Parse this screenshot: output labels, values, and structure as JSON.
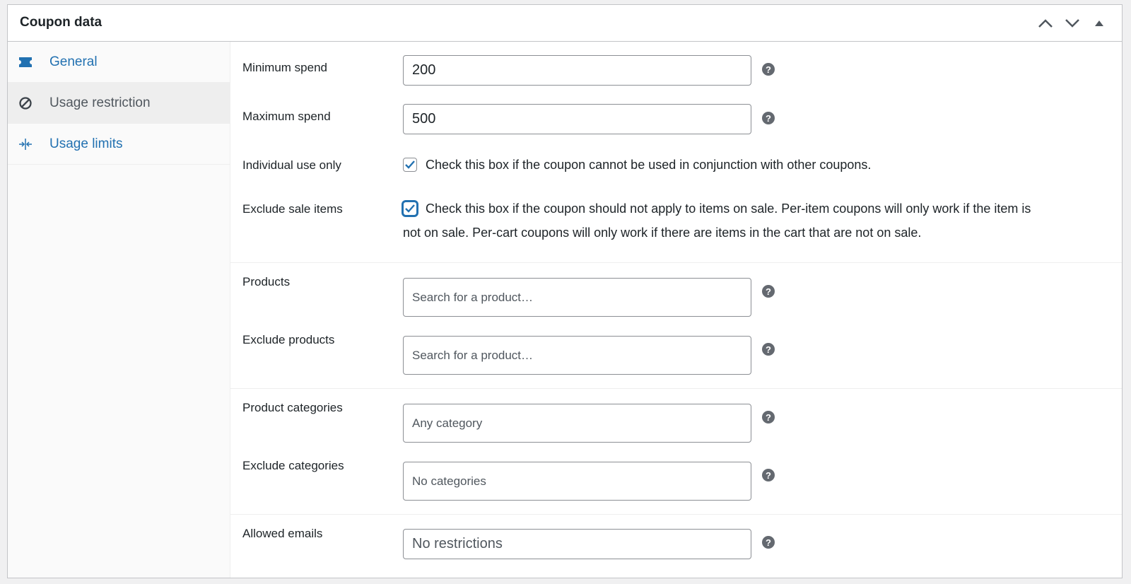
{
  "panel": {
    "title": "Coupon data"
  },
  "header": {
    "move_up_icon": "chevron-up-icon",
    "move_down_icon": "chevron-down-icon",
    "toggle_icon": "triangle-up-icon"
  },
  "tabs": [
    {
      "label": "General",
      "icon": "ticket-icon",
      "active": false
    },
    {
      "label": "Usage restriction",
      "icon": "block-icon",
      "active": true
    },
    {
      "label": "Usage limits",
      "icon": "limits-icon",
      "active": false
    }
  ],
  "fields": {
    "minimum_spend": {
      "label": "Minimum spend",
      "value": "200"
    },
    "maximum_spend": {
      "label": "Maximum spend",
      "value": "500"
    },
    "individual_use": {
      "label": "Individual use only",
      "checked": true,
      "description": "Check this box if the coupon cannot be used in conjunction with other coupons."
    },
    "exclude_sale": {
      "label": "Exclude sale items",
      "checked": true,
      "description_line1": "Check this box if the coupon should not apply to items on sale. Per-item coupons will only work if the item is",
      "description_line2": "not on sale. Per-cart coupons will only work if there are items in the cart that are not on sale."
    },
    "products": {
      "label": "Products",
      "placeholder": "Search for a product…"
    },
    "exclude_products": {
      "label": "Exclude products",
      "placeholder": "Search for a product…"
    },
    "product_categories": {
      "label": "Product categories",
      "placeholder": "Any category"
    },
    "exclude_categories": {
      "label": "Exclude categories",
      "placeholder": "No categories"
    },
    "allowed_emails": {
      "label": "Allowed emails",
      "placeholder": "No restrictions"
    }
  },
  "help_glyph": "?",
  "colors": {
    "link": "#2271b1",
    "text": "#1d2327",
    "border": "#c3c4c7",
    "help": "#646970"
  }
}
